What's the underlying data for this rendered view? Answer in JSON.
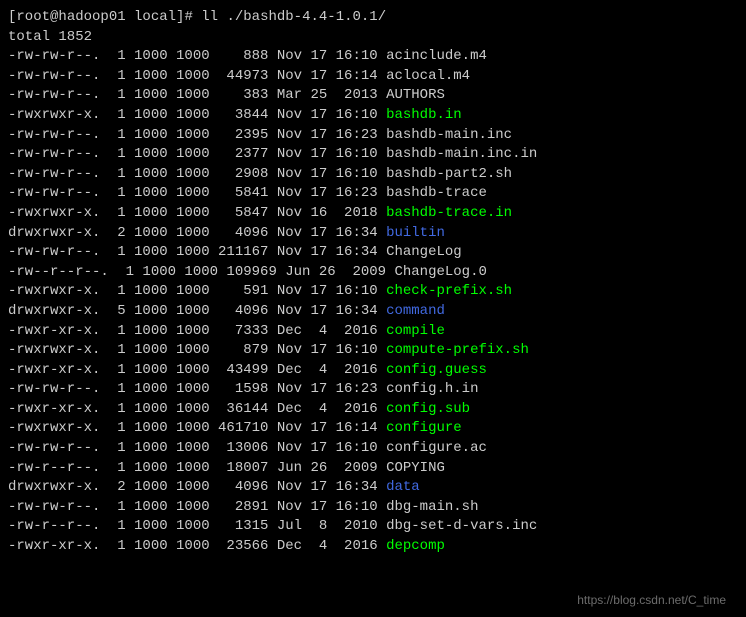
{
  "prompt": {
    "userhost": "root@hadoop01",
    "cwd": "local",
    "command": "ll ./bashdb-4.4-1.0.1/"
  },
  "total_line": "total 1852",
  "rows": [
    {
      "perm": "-rw-rw-r--.",
      "links": "1",
      "uid": "1000",
      "gid": "1000",
      "size": "   888",
      "mon": "Nov",
      "day": "17",
      "time": "16:10",
      "name": "acinclude.m4",
      "color": ""
    },
    {
      "perm": "-rw-rw-r--.",
      "links": "1",
      "uid": "1000",
      "gid": "1000",
      "size": " 44973",
      "mon": "Nov",
      "day": "17",
      "time": "16:14",
      "name": "aclocal.m4",
      "color": ""
    },
    {
      "perm": "-rw-rw-r--.",
      "links": "1",
      "uid": "1000",
      "gid": "1000",
      "size": "   383",
      "mon": "Mar",
      "day": "25",
      "time": " 2013",
      "name": "AUTHORS",
      "color": ""
    },
    {
      "perm": "-rwxrwxr-x.",
      "links": "1",
      "uid": "1000",
      "gid": "1000",
      "size": "  3844",
      "mon": "Nov",
      "day": "17",
      "time": "16:10",
      "name": "bashdb.in",
      "color": "green"
    },
    {
      "perm": "-rw-rw-r--.",
      "links": "1",
      "uid": "1000",
      "gid": "1000",
      "size": "  2395",
      "mon": "Nov",
      "day": "17",
      "time": "16:23",
      "name": "bashdb-main.inc",
      "color": ""
    },
    {
      "perm": "-rw-rw-r--.",
      "links": "1",
      "uid": "1000",
      "gid": "1000",
      "size": "  2377",
      "mon": "Nov",
      "day": "17",
      "time": "16:10",
      "name": "bashdb-main.inc.in",
      "color": ""
    },
    {
      "perm": "-rw-rw-r--.",
      "links": "1",
      "uid": "1000",
      "gid": "1000",
      "size": "  2908",
      "mon": "Nov",
      "day": "17",
      "time": "16:10",
      "name": "bashdb-part2.sh",
      "color": ""
    },
    {
      "perm": "-rw-rw-r--.",
      "links": "1",
      "uid": "1000",
      "gid": "1000",
      "size": "  5841",
      "mon": "Nov",
      "day": "17",
      "time": "16:23",
      "name": "bashdb-trace",
      "color": ""
    },
    {
      "perm": "-rwxrwxr-x.",
      "links": "1",
      "uid": "1000",
      "gid": "1000",
      "size": "  5847",
      "mon": "Nov",
      "day": "16",
      "time": " 2018",
      "name": "bashdb-trace.in",
      "color": "green"
    },
    {
      "perm": "drwxrwxr-x.",
      "links": "2",
      "uid": "1000",
      "gid": "1000",
      "size": "  4096",
      "mon": "Nov",
      "day": "17",
      "time": "16:34",
      "name": "builtin",
      "color": "blue"
    },
    {
      "perm": "-rw-rw-r--.",
      "links": "1",
      "uid": "1000",
      "gid": "1000",
      "size": "211167",
      "mon": "Nov",
      "day": "17",
      "time": "16:34",
      "name": "ChangeLog",
      "color": ""
    },
    {
      "perm": "-rw--r--r--.",
      "links": "1",
      "uid": "1000",
      "gid": "1000",
      "size": "109969",
      "mon": "Jun",
      "day": "26",
      "time": " 2009",
      "name": "ChangeLog.0",
      "color": ""
    },
    {
      "perm": "-rwxrwxr-x.",
      "links": "1",
      "uid": "1000",
      "gid": "1000",
      "size": "   591",
      "mon": "Nov",
      "day": "17",
      "time": "16:10",
      "name": "check-prefix.sh",
      "color": "green"
    },
    {
      "perm": "drwxrwxr-x.",
      "links": "5",
      "uid": "1000",
      "gid": "1000",
      "size": "  4096",
      "mon": "Nov",
      "day": "17",
      "time": "16:34",
      "name": "command",
      "color": "blue"
    },
    {
      "perm": "-rwxr-xr-x.",
      "links": "1",
      "uid": "1000",
      "gid": "1000",
      "size": "  7333",
      "mon": "Dec",
      "day": " 4",
      "time": " 2016",
      "name": "compile",
      "color": "green"
    },
    {
      "perm": "-rwxrwxr-x.",
      "links": "1",
      "uid": "1000",
      "gid": "1000",
      "size": "   879",
      "mon": "Nov",
      "day": "17",
      "time": "16:10",
      "name": "compute-prefix.sh",
      "color": "green"
    },
    {
      "perm": "-rwxr-xr-x.",
      "links": "1",
      "uid": "1000",
      "gid": "1000",
      "size": " 43499",
      "mon": "Dec",
      "day": " 4",
      "time": " 2016",
      "name": "config.guess",
      "color": "green"
    },
    {
      "perm": "-rw-rw-r--.",
      "links": "1",
      "uid": "1000",
      "gid": "1000",
      "size": "  1598",
      "mon": "Nov",
      "day": "17",
      "time": "16:23",
      "name": "config.h.in",
      "color": ""
    },
    {
      "perm": "-rwxr-xr-x.",
      "links": "1",
      "uid": "1000",
      "gid": "1000",
      "size": " 36144",
      "mon": "Dec",
      "day": " 4",
      "time": " 2016",
      "name": "config.sub",
      "color": "green"
    },
    {
      "perm": "-rwxrwxr-x.",
      "links": "1",
      "uid": "1000",
      "gid": "1000",
      "size": "461710",
      "mon": "Nov",
      "day": "17",
      "time": "16:14",
      "name": "configure",
      "color": "green"
    },
    {
      "perm": "-rw-rw-r--.",
      "links": "1",
      "uid": "1000",
      "gid": "1000",
      "size": " 13006",
      "mon": "Nov",
      "day": "17",
      "time": "16:10",
      "name": "configure.ac",
      "color": ""
    },
    {
      "perm": "-rw-r--r--.",
      "links": "1",
      "uid": "1000",
      "gid": "1000",
      "size": " 18007",
      "mon": "Jun",
      "day": "26",
      "time": " 2009",
      "name": "COPYING",
      "color": ""
    },
    {
      "perm": "drwxrwxr-x.",
      "links": "2",
      "uid": "1000",
      "gid": "1000",
      "size": "  4096",
      "mon": "Nov",
      "day": "17",
      "time": "16:34",
      "name": "data",
      "color": "blue"
    },
    {
      "perm": "-rw-rw-r--.",
      "links": "1",
      "uid": "1000",
      "gid": "1000",
      "size": "  2891",
      "mon": "Nov",
      "day": "17",
      "time": "16:10",
      "name": "dbg-main.sh",
      "color": ""
    },
    {
      "perm": "-rw-r--r--.",
      "links": "1",
      "uid": "1000",
      "gid": "1000",
      "size": "  1315",
      "mon": "Jul",
      "day": " 8",
      "time": " 2010",
      "name": "dbg-set-d-vars.inc",
      "color": ""
    },
    {
      "perm": "-rwxr-xr-x.",
      "links": "1",
      "uid": "1000",
      "gid": "1000",
      "size": " 23566",
      "mon": "Dec",
      "day": " 4",
      "time": " 2016",
      "name": "depcomp",
      "color": "green"
    }
  ],
  "watermark": "https://blog.csdn.net/C_time"
}
